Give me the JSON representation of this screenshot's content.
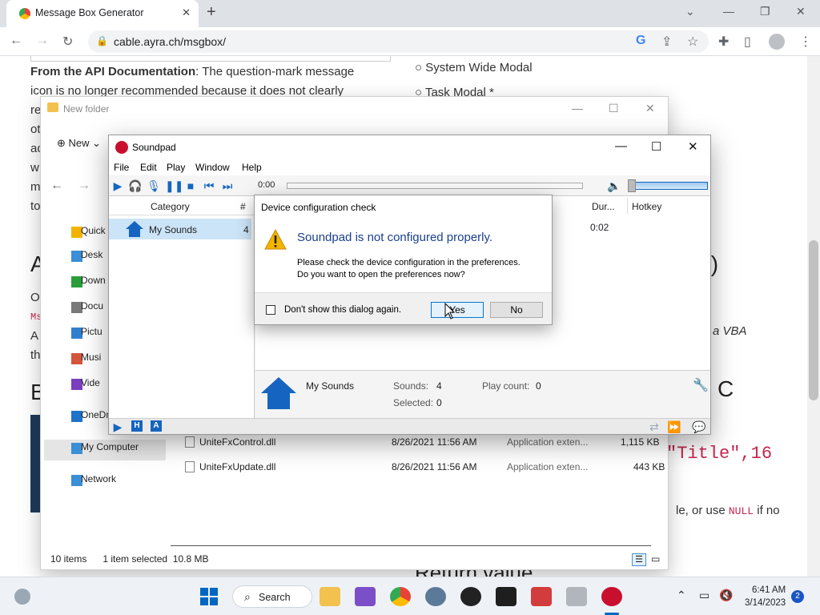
{
  "browser": {
    "tab_title": "Message Box Generator",
    "url": "cable.ayra.ch/msgbox/"
  },
  "page": {
    "doc_bold": "From the API Documentation",
    "doc_rest": ": The question-mark message",
    "doc_line2": "icon is no longer recommended because it does not clearly",
    "doc_line3_start": "re",
    "opt1": "System Wide Modal",
    "opt2": "Task Modal *",
    "frag_o": "O",
    "frag_a": "A",
    "frag_th": "th",
    "frag_ms": "Ms",
    "frag_b": "B",
    "frag_to": "to",
    "frag_ot": "ot",
    "frag_ac": "ac",
    "frag_w": "w",
    "frag_m": "m",
    "frag_t_paren": "t)",
    "frag_vba": "a VBA",
    "frag_c": "C",
    "code_title": "\"Title\",16",
    "frag_null_pre": "le, or use",
    "frag_null": "NULL",
    "frag_null_post": "if no",
    "return_value": "Return value"
  },
  "explorer": {
    "title": "New folder",
    "new_label": "New",
    "nav": [
      {
        "label": "Quick",
        "color": "#f2b400"
      },
      {
        "label": "Desk",
        "color": "#3a8fd6"
      },
      {
        "label": "Down",
        "color": "#2a9d3a"
      },
      {
        "label": "Docu",
        "color": "#7a7a7a"
      },
      {
        "label": "Pictu",
        "color": "#2f7fd0"
      },
      {
        "label": "Musi",
        "color": "#d4553c"
      },
      {
        "label": "Vide",
        "color": "#7a3fbf"
      },
      {
        "label": "OneDr",
        "color": "#1e73c8"
      },
      {
        "label": "My Computer",
        "color": "#3a8fd6"
      },
      {
        "label": "Network",
        "color": "#3a8fd6"
      }
    ],
    "files": [
      {
        "name": "UniteFxControl.dll",
        "date": "8/26/2021 11:56 AM",
        "type": "Application exten...",
        "size": "1,115 KB"
      },
      {
        "name": "UniteFxUpdate.dll",
        "date": "8/26/2021 11:56 AM",
        "type": "Application exten...",
        "size": "443 KB"
      }
    ],
    "status_items": "10 items",
    "status_selected": "1 item selected",
    "status_size": "10.8 MB"
  },
  "soundpad": {
    "title": "Soundpad",
    "menu": [
      "File",
      "Edit",
      "Play",
      "Window",
      "Help"
    ],
    "time": "0:00",
    "col_category": "Category",
    "col_hash": "#",
    "col_duration": "Dur...",
    "col_hotkey": "Hotkey",
    "category_name": "My Sounds",
    "category_count": "4",
    "duration_value": "0:02",
    "info_name": "My Sounds",
    "sounds_label": "Sounds:",
    "sounds_value": "4",
    "playcount_label": "Play count:",
    "playcount_value": "0",
    "selected_label": "Selected:",
    "selected_value": "0"
  },
  "dialog": {
    "title": "Device configuration check",
    "heading": "Soundpad is not configured properly.",
    "line1": "Please check the device configuration in the preferences.",
    "line2": "Do you want to open the preferences now?",
    "checkbox_label": "Don't show this dialog again.",
    "yes": "Yes",
    "no": "No"
  },
  "taskbar": {
    "search": "Search",
    "time": "6:41 AM",
    "date": "3/14/2023",
    "notifications": "2"
  },
  "colors": {
    "accent": "#1565c0",
    "soundpad_red": "#c8102e",
    "dialog_heading": "#1a3f8f"
  }
}
